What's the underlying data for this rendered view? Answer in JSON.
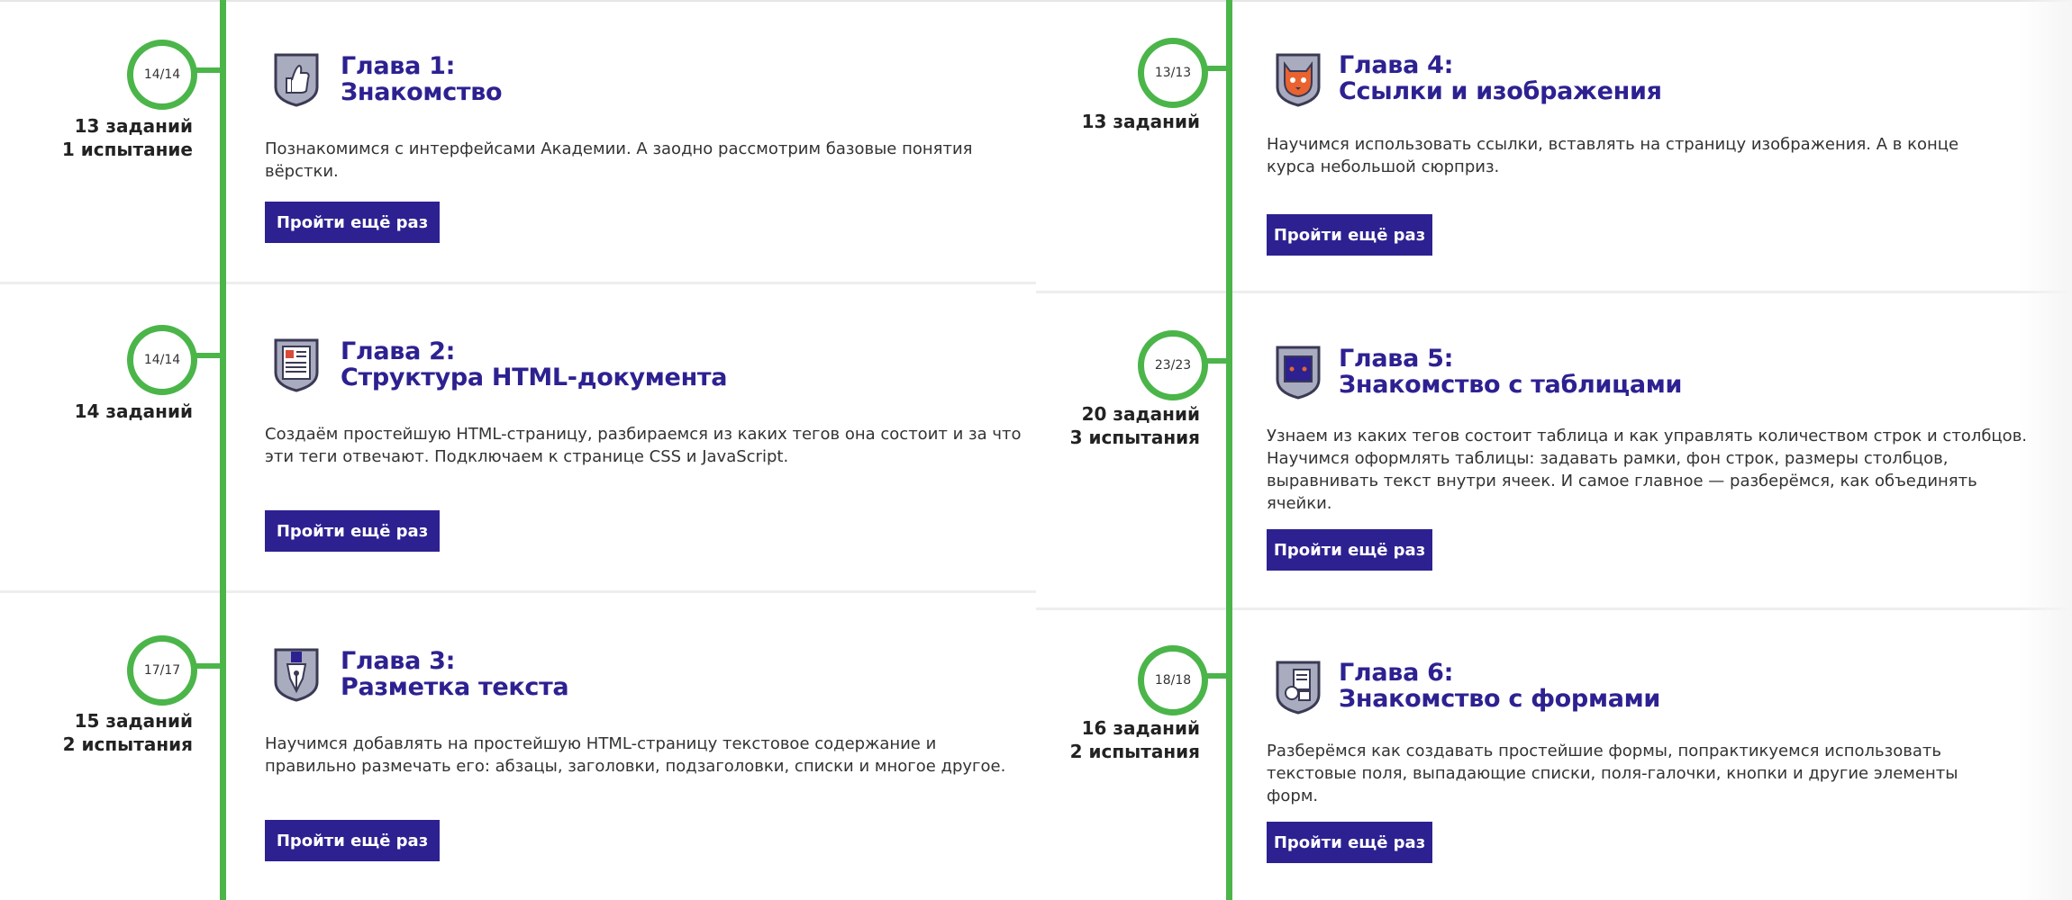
{
  "chapters": [
    {
      "progress": "14/14",
      "stats_line1": "13 заданий",
      "stats_line2": "1 испытание",
      "title_line1": "Глава 1:",
      "title_line2": "Знакомство",
      "description": "Познакомимся с интерфейсами Академии. А заодно рассмотрим базовые понятия вёрстки.",
      "button_label": "Пройти ещё раз",
      "icon": "thumbs-up-shield-icon"
    },
    {
      "progress": "14/14",
      "stats_line1": "14 заданий",
      "stats_line2": "",
      "title_line1": "Глава 2:",
      "title_line2": "Структура HTML-документа",
      "description": "Создаём простейшую HTML-страницу, разбираемся из каких тегов она состоит и за что эти теги отвечают. Подключаем к странице CSS и JavaScript.",
      "button_label": "Пройти ещё раз",
      "icon": "document-shield-icon"
    },
    {
      "progress": "17/17",
      "stats_line1": "15 заданий",
      "stats_line2": "2 испытания",
      "title_line1": "Глава 3:",
      "title_line2": "Разметка текста",
      "description": "Научимся добавлять на простейшую HTML-страницу текстовое содержание и правильно размечать его: абзацы, заголовки, подзаголовки, списки и многое другое.",
      "button_label": "Пройти ещё раз",
      "icon": "pen-nib-shield-icon"
    },
    {
      "progress": "13/13",
      "stats_line1": "13 заданий",
      "stats_line2": "",
      "title_line1": "Глава 4:",
      "title_line2": "Ссылки и изображения",
      "description": "Научимся использовать ссылки, вставлять на страницу изображения. А в конце курса небольшой сюрприз.",
      "button_label": "Пройти ещё раз",
      "icon": "cat-shield-icon"
    },
    {
      "progress": "23/23",
      "stats_line1": "20 заданий",
      "stats_line2": "3 испытания",
      "title_line1": "Глава 5:",
      "title_line2": "Знакомство с таблицами",
      "description": "Узнаем из каких тегов состоит таблица и как управлять количеством строк и столбцов. Научимся оформлять таблицы: задавать рамки, фон строк, размеры столбцов, выравнивать текст внутри ячеек. И самое главное — разберёмся, как объединять ячейки.",
      "button_label": "Пройти ещё раз",
      "icon": "table-shield-icon"
    },
    {
      "progress": "18/18",
      "stats_line1": "16 заданий",
      "stats_line2": "2 испытания",
      "title_line1": "Глава 6:",
      "title_line2": "Знакомство с формами",
      "description": "Разберёмся как создавать простейшие формы, попрактикуемся использовать текстовые поля, выпадающие списки, поля-галочки, кнопки и другие элементы форм.",
      "button_label": "Пройти ещё раз",
      "icon": "form-shield-icon"
    }
  ]
}
